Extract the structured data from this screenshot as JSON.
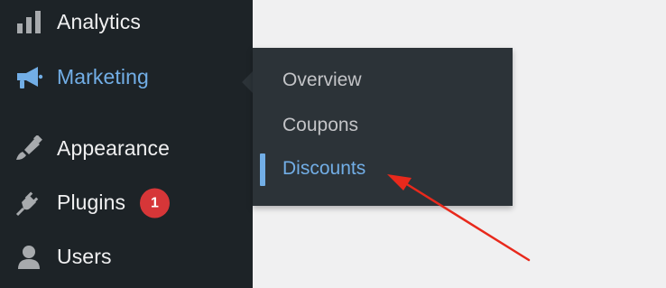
{
  "sidebar": {
    "items": [
      {
        "label": "Analytics",
        "icon": "bar-chart-icon"
      },
      {
        "label": "Marketing",
        "icon": "megaphone-icon",
        "active": true
      },
      {
        "label": "Appearance",
        "icon": "paintbrush-icon"
      },
      {
        "label": "Plugins",
        "icon": "plug-icon",
        "badge": "1"
      },
      {
        "label": "Users",
        "icon": "user-icon"
      }
    ]
  },
  "flyout": {
    "items": [
      {
        "label": "Overview"
      },
      {
        "label": "Coupons"
      },
      {
        "label": "Discounts",
        "current": true
      }
    ]
  },
  "colors": {
    "sidebar_bg": "#1d2327",
    "flyout_bg": "#2c3338",
    "accent": "#72aee6",
    "badge": "#d63638",
    "annotation_arrow": "#e8291c",
    "page_bg": "#f0f0f1"
  }
}
